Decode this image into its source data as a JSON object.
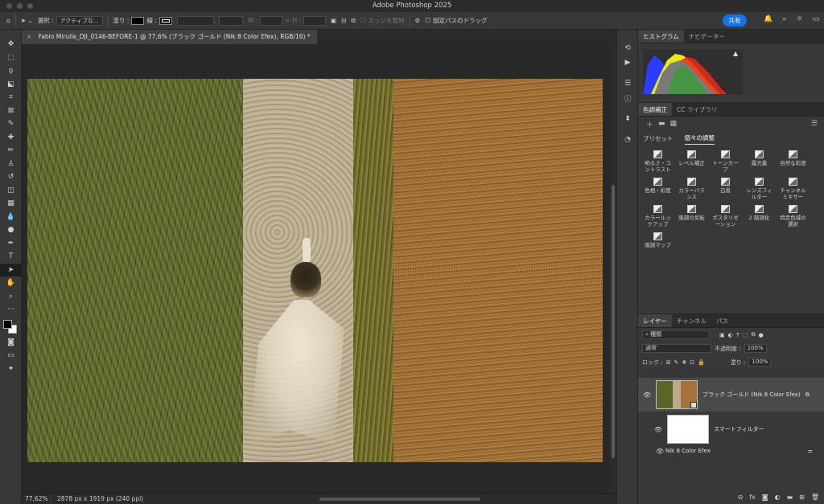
{
  "app": {
    "title": "Adobe Photoshop 2025"
  },
  "options_bar": {
    "select_label": "選択 :",
    "select_value": "アクティブな...",
    "fill_label": "塗り :",
    "stroke_label": "線 :",
    "w_label": "W :",
    "h_label": "H :",
    "refine_edge": "エッジを整列",
    "constrain_path": "固定パスのドラッグ",
    "share_label": "共有"
  },
  "document": {
    "tab_title": "Fabio Mirulla_DJI_0146-BEFORE-1 @ 77,6% (ブラック ゴールド (Nik 8 Color Efex), RGB/16) *",
    "zoom": "77,62%",
    "info": "2878 px x 1919 px (240 ppi)"
  },
  "histogram_panel": {
    "tabs": [
      "ヒストグラム",
      "ナビゲーター"
    ]
  },
  "adjustments_panel": {
    "tabs": [
      "色調補正",
      "CC ライブラリ"
    ],
    "subtabs": [
      "プリセット",
      "個々の調整"
    ],
    "items": [
      "明るさ・コントラスト",
      "レベル補正",
      "トーンカーブ",
      "露光量",
      "自然な彩度",
      "色相・彩度",
      "カラーバランス",
      "白黒",
      "レンズフィルター",
      "チャンネルミキサー",
      "カラールックアップ",
      "階調の反転",
      "ポスタリゼーション",
      "2 階調化",
      "特定色域の選択",
      "階調マップ"
    ]
  },
  "layers_panel": {
    "tabs": [
      "レイヤー",
      "チャンネル",
      "パス"
    ],
    "filter_kind": "種類",
    "blend_mode": "通常",
    "opacity_label": "不透明度 :",
    "opacity_value": "100%",
    "lock_label": "ロック :",
    "fill_label": "塗り :",
    "fill_value": "100%",
    "layers": [
      {
        "name": "ブラック ゴールド (Nik 8 Color Efex)"
      },
      {
        "name": "スマートフィルター"
      },
      {
        "name": "Nik 8 Color Efex"
      }
    ],
    "bottom_icons": [
      "link-icon",
      "fx-icon",
      "mask-icon",
      "adjustment-icon",
      "folder-icon",
      "new-layer-icon",
      "trash-icon"
    ]
  }
}
